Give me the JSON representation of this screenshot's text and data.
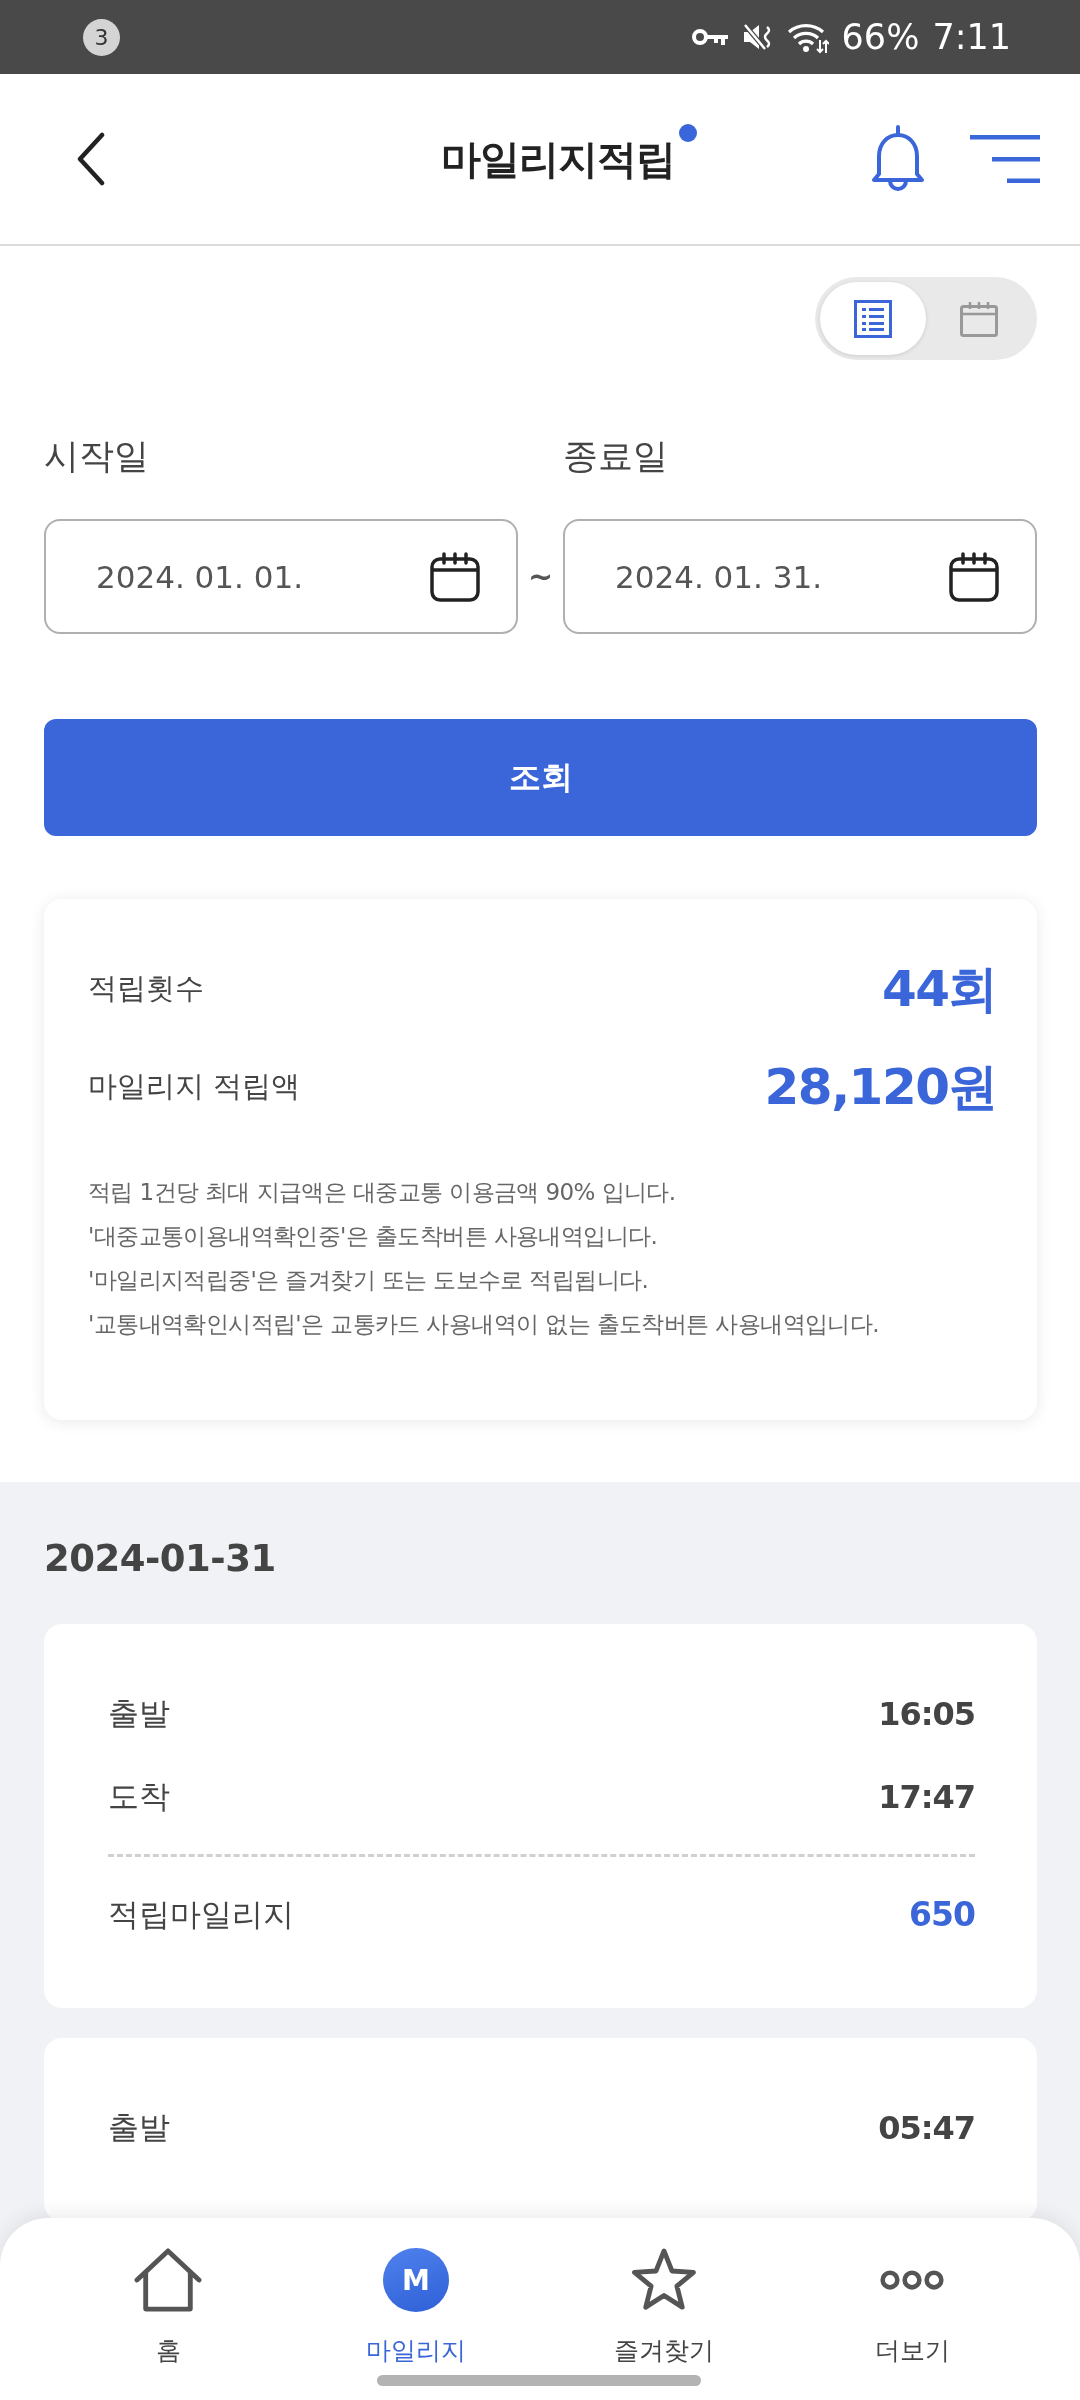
{
  "status_bar": {
    "notification_count": "3",
    "battery": "66%",
    "time": "7:11"
  },
  "header": {
    "title": "마일리지적립"
  },
  "view_toggle": [
    {
      "kind": "list",
      "selected": true
    },
    {
      "kind": "calendar",
      "selected": false
    }
  ],
  "date_range": {
    "start": {
      "label": "시작일",
      "value": "2024. 01. 01."
    },
    "separator": "~",
    "end": {
      "label": "종료일",
      "value": "2024. 01. 31."
    }
  },
  "search_button": {
    "label": "조회"
  },
  "summary": {
    "rows": [
      {
        "label": "적립횟수",
        "value": "44회"
      },
      {
        "label": "마일리지 적립액",
        "value": "28,120원"
      }
    ],
    "notes": [
      "적립 1건당 최대 지급액은 대중교통 이용금액 90% 입니다.",
      "'대중교통이용내역확인중'은 출도착버튼 사용내역입니다.",
      "'마일리지적립중'은 즐겨찾기 또는 도보수로 적립됩니다.",
      "'교통내역확인시적립'은 교통카드 사용내역이 없는 출도착버튼 사용내역입니다."
    ]
  },
  "history": [
    {
      "date": "2024-01-31",
      "records": [
        {
          "times": [
            {
              "label": "출발",
              "value": "16:05"
            },
            {
              "label": "도착",
              "value": "17:47"
            }
          ],
          "mileage": {
            "label": "적립마일리지",
            "value": "650"
          }
        },
        {
          "times": [
            {
              "label": "출발",
              "value": "05:47"
            }
          ]
        }
      ]
    }
  ],
  "bottom_nav": [
    {
      "kind": "home",
      "label": "홈",
      "selected": false
    },
    {
      "kind": "mileage",
      "icon_text": "M",
      "label": "마일리지",
      "selected": true
    },
    {
      "kind": "favorites",
      "label": "즐겨찾기",
      "selected": false
    },
    {
      "kind": "more",
      "label": "더보기",
      "selected": false
    }
  ]
}
